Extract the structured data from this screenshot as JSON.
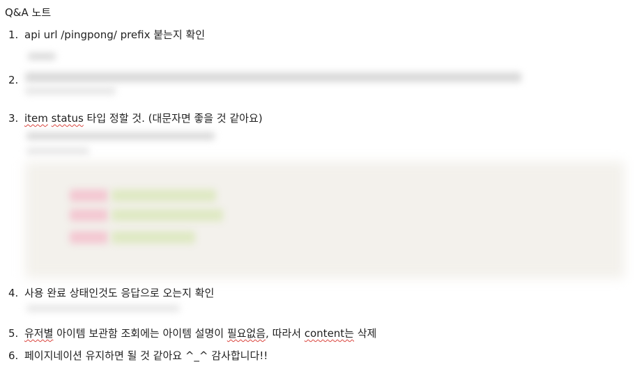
{
  "note": {
    "title": "Q&A 노트"
  },
  "items": [
    {
      "number": "1.",
      "segments": [
        {
          "text": "api url /pingpong/ prefix 붙는지 확인",
          "squiggle": false
        }
      ]
    },
    {
      "number": "2.",
      "segments": []
    },
    {
      "number": "3.",
      "segments": [
        {
          "text": "item",
          "squiggle": true
        },
        {
          "text": " ",
          "squiggle": false
        },
        {
          "text": "status",
          "squiggle": true
        },
        {
          "text": " 타입 정할 것. (대문자면 좋을 것 같아요)",
          "squiggle": false
        }
      ]
    },
    {
      "number": "4.",
      "segments": [
        {
          "text": "사용 완료 상태인것도 응답으로 오는지 확인",
          "squiggle": false
        }
      ]
    },
    {
      "number": "5.",
      "segments": [
        {
          "text": "유저별",
          "squiggle": true
        },
        {
          "text": " 아이템 보관함 조회에는 아이템 설명이 ",
          "squiggle": false
        },
        {
          "text": "필요없음",
          "squiggle": true
        },
        {
          "text": ", 따라서 ",
          "squiggle": false
        },
        {
          "text": "content는",
          "squiggle": true
        },
        {
          "text": " 삭제",
          "squiggle": false
        }
      ]
    },
    {
      "number": "6.",
      "segments": [
        {
          "text": "페이지네이션 유지하면 될 것 같아요 ^_^ 감사합니다!!",
          "squiggle": false
        }
      ]
    }
  ]
}
